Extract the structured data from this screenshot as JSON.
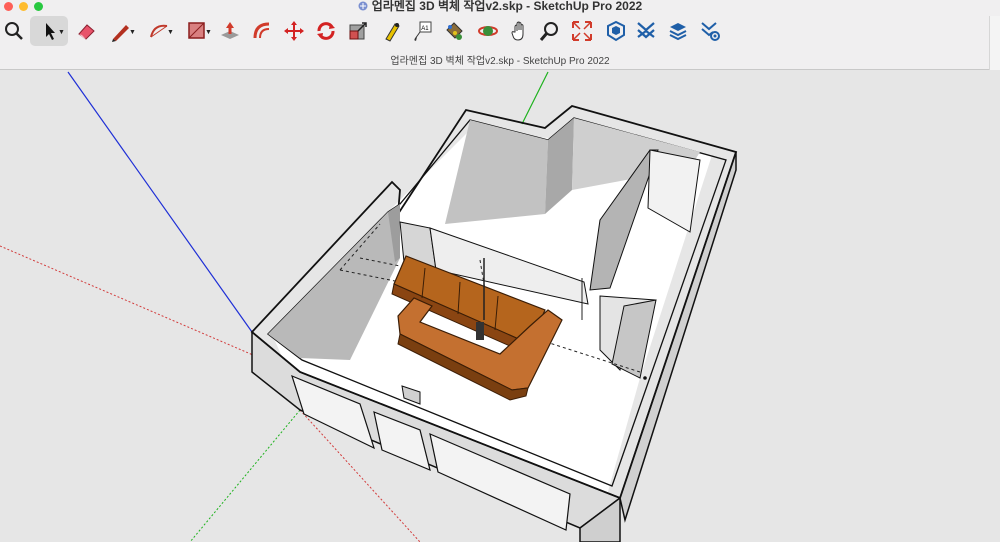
{
  "window": {
    "title": "업라멘집 3D 벽체 작업v2.skp - SketchUp Pro 2022",
    "document_title": "업라멘집 3D 벽체 작업v2.skp - SketchUp Pro 2022"
  },
  "toolbar": {
    "tools": [
      {
        "name": "zoom-icon"
      },
      {
        "name": "select-icon"
      },
      {
        "name": "eraser-icon"
      },
      {
        "name": "line-icon"
      },
      {
        "name": "arc-icon"
      },
      {
        "name": "rectangle-icon"
      },
      {
        "name": "push-pull-icon"
      },
      {
        "name": "offset-icon"
      },
      {
        "name": "move-icon"
      },
      {
        "name": "rotate-icon"
      },
      {
        "name": "scale-icon"
      },
      {
        "name": "tape-measure-icon"
      },
      {
        "name": "text-icon"
      },
      {
        "name": "paint-bucket-icon"
      },
      {
        "name": "orbit-icon"
      },
      {
        "name": "pan-icon"
      },
      {
        "name": "zoom-tool-icon"
      },
      {
        "name": "zoom-extents-icon"
      },
      {
        "name": "3d-warehouse-icon"
      },
      {
        "name": "extension-warehouse-icon"
      },
      {
        "name": "layout-icon"
      },
      {
        "name": "extension-manager-icon"
      }
    ],
    "text_tool_glyph": "A1"
  },
  "colors": {
    "axis_blue": "#1f2fd6",
    "axis_green": "#1db21d",
    "axis_red": "#d23c3c",
    "wall_top": "#ffffff",
    "wall_inner": "#b9b9b9",
    "wall_outer": "#dcdcdc",
    "floor": "#ffffff",
    "wood": "#b5651d",
    "wood_dark": "#7a3f10"
  }
}
